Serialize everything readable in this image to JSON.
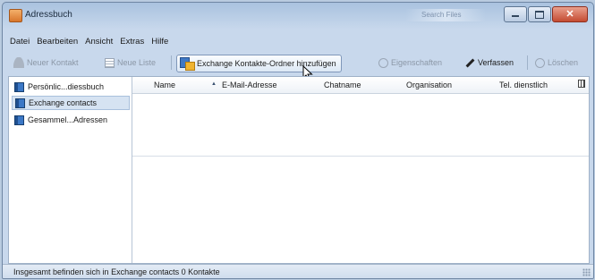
{
  "window": {
    "title": "Adressbuch",
    "blurred_title": "Search Files"
  },
  "menubar": {
    "items": [
      "Datei",
      "Bearbeiten",
      "Ansicht",
      "Extras",
      "Hilfe"
    ]
  },
  "toolbar": {
    "new_contact": "Neuer Kontakt",
    "new_list": "Neue Liste",
    "add_exchange_folder": "Exchange Kontakte-Ordner hinzufügen",
    "properties": "Eigenschaften",
    "compose": "Verfassen",
    "delete": "Löschen"
  },
  "sidebar": {
    "items": [
      {
        "label": "Persönlic...diessbuch"
      },
      {
        "label": "Exchange contacts",
        "selected": true
      },
      {
        "label": "Gesammel...Adressen"
      }
    ]
  },
  "list": {
    "columns": [
      "Name",
      "E-Mail-Adresse",
      "Chatname",
      "Organisation",
      "Tel. dienstlich"
    ],
    "rows": []
  },
  "status": {
    "text": "Insgesamt befinden sich in Exchange contacts 0 Kontakte"
  },
  "colors": {
    "accent": "#3c78c6",
    "selection": "#d6e3f2",
    "window_frame": "#a9c2df"
  }
}
